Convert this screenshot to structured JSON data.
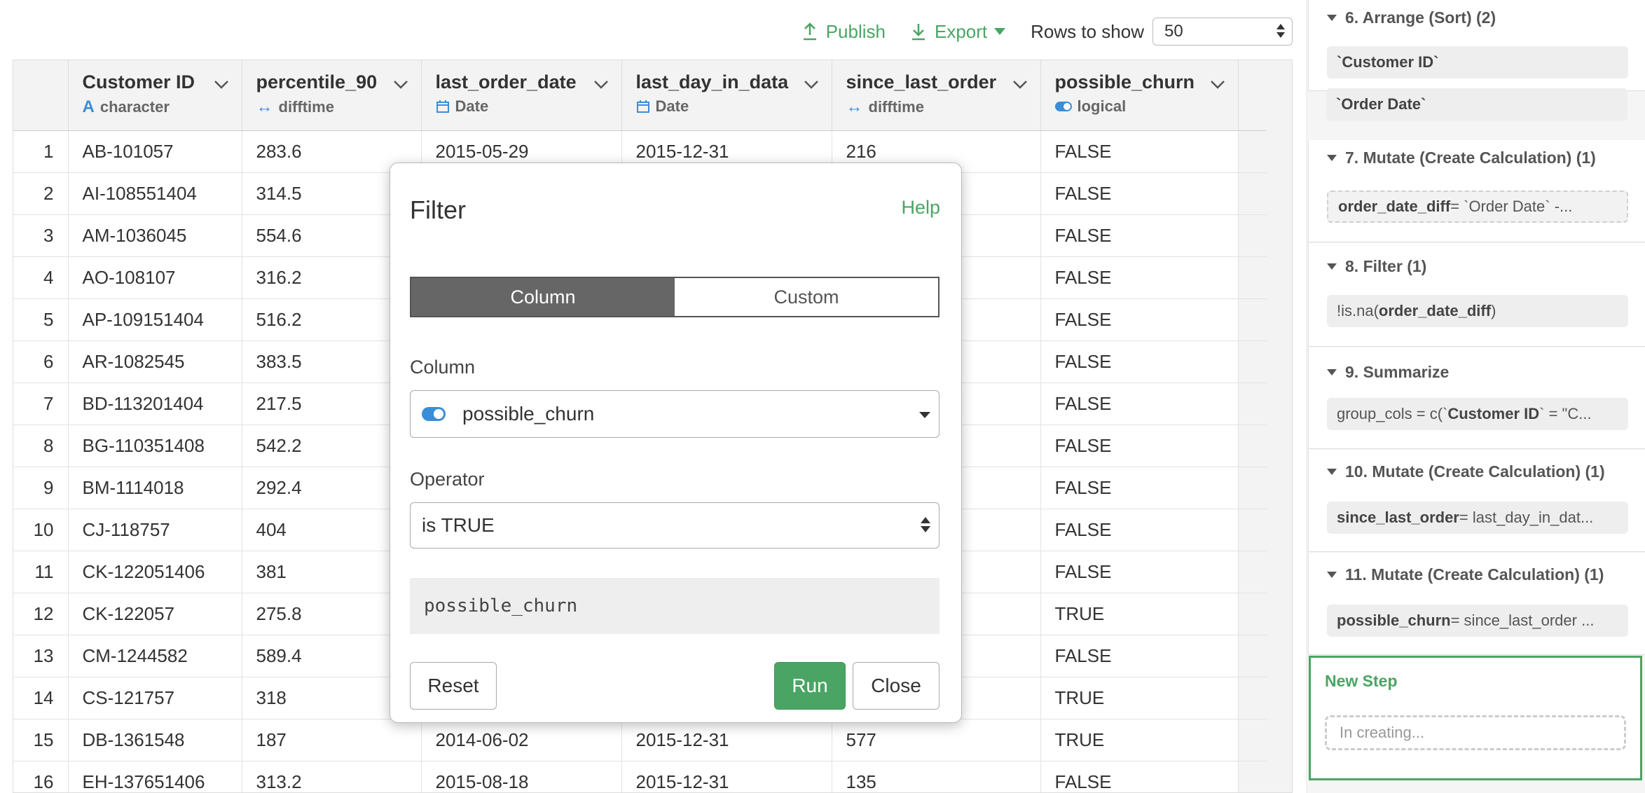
{
  "toolbar": {
    "publish_label": "Publish",
    "export_label": "Export",
    "rows_to_show_label": "Rows to show",
    "rows_to_show_value": "50"
  },
  "table": {
    "columns": [
      {
        "name": "Customer ID",
        "type": "character",
        "type_icon": "character-icon"
      },
      {
        "name": "percentile_90",
        "type": "difftime",
        "type_icon": "difftime-icon"
      },
      {
        "name": "last_order_date",
        "type": "Date",
        "type_icon": "calendar-icon"
      },
      {
        "name": "last_day_in_data",
        "type": "Date",
        "type_icon": "calendar-icon"
      },
      {
        "name": "since_last_order",
        "type": "difftime",
        "type_icon": "difftime-icon"
      },
      {
        "name": "possible_churn",
        "type": "logical",
        "type_icon": "toggle-icon"
      }
    ],
    "rows": [
      {
        "i": "1",
        "c": [
          "AB-101057",
          "283.6",
          "2015-05-29",
          "2015-12-31",
          "216",
          "FALSE"
        ]
      },
      {
        "i": "2",
        "c": [
          "AI-108551404",
          "314.5",
          "",
          "",
          "",
          "FALSE"
        ]
      },
      {
        "i": "3",
        "c": [
          "AM-1036045",
          "554.6",
          "",
          "",
          "",
          "FALSE"
        ]
      },
      {
        "i": "4",
        "c": [
          "AO-108107",
          "316.2",
          "",
          "",
          "",
          "FALSE"
        ]
      },
      {
        "i": "5",
        "c": [
          "AP-109151404",
          "516.2",
          "",
          "",
          "",
          "FALSE"
        ]
      },
      {
        "i": "6",
        "c": [
          "AR-1082545",
          "383.5",
          "",
          "",
          "",
          "FALSE"
        ]
      },
      {
        "i": "7",
        "c": [
          "BD-113201404",
          "217.5",
          "",
          "",
          "",
          "FALSE"
        ]
      },
      {
        "i": "8",
        "c": [
          "BG-110351408",
          "542.2",
          "",
          "",
          "",
          "FALSE"
        ]
      },
      {
        "i": "9",
        "c": [
          "BM-1114018",
          "292.4",
          "",
          "",
          "",
          "FALSE"
        ]
      },
      {
        "i": "10",
        "c": [
          "CJ-118757",
          "404",
          "",
          "",
          "",
          "FALSE"
        ]
      },
      {
        "i": "11",
        "c": [
          "CK-122051406",
          "381",
          "",
          "",
          "",
          "FALSE"
        ]
      },
      {
        "i": "12",
        "c": [
          "CK-122057",
          "275.8",
          "",
          "",
          "",
          "TRUE"
        ]
      },
      {
        "i": "13",
        "c": [
          "CM-1244582",
          "589.4",
          "",
          "",
          "",
          "FALSE"
        ]
      },
      {
        "i": "14",
        "c": [
          "CS-121757",
          "318",
          "",
          "",
          "",
          "TRUE"
        ]
      },
      {
        "i": "15",
        "c": [
          "DB-1361548",
          "187",
          "2014-06-02",
          "2015-12-31",
          "577",
          "TRUE"
        ]
      },
      {
        "i": "16",
        "c": [
          "EH-137651406",
          "313.2",
          "2015-08-18",
          "2015-12-31",
          "135",
          "FALSE"
        ]
      }
    ]
  },
  "dialog": {
    "title": "Filter",
    "help_label": "Help",
    "tabs": [
      "Column",
      "Custom"
    ],
    "active_tab": "Column",
    "column_label": "Column",
    "column_value": "possible_churn",
    "operator_label": "Operator",
    "operator_value": "is TRUE",
    "code_preview": "possible_churn",
    "reset_label": "Reset",
    "run_label": "Run",
    "close_label": "Close"
  },
  "steps": [
    {
      "title": "6. Arrange (Sort) (2)",
      "pills": [
        {
          "html": "`Customer ID`"
        },
        {
          "html": "`Order Date`"
        }
      ]
    },
    {
      "title": "7. Mutate (Create Calculation) (1)",
      "pills": [
        {
          "bold": "order_date_diff",
          "text": " = `Order Date` -..."
        }
      ]
    },
    {
      "title": "8. Filter (1)",
      "pills": [
        {
          "pre": "!is.na(",
          "bold": "order_date_diff",
          "text": ")"
        }
      ]
    },
    {
      "title": "9. Summarize",
      "pills": [
        {
          "pre": "group_cols = c(`",
          "bold": "Customer ID",
          "text": "` = \"C..."
        }
      ]
    },
    {
      "title": "10. Mutate (Create Calculation) (1)",
      "pills": [
        {
          "bold": "since_last_order",
          "text": " = last_day_in_dat..."
        }
      ]
    },
    {
      "title": "11. Mutate (Create Calculation) (1)",
      "pills": [
        {
          "bold": "possible_churn",
          "text": " = since_last_order ..."
        }
      ]
    }
  ],
  "new_step": {
    "title": "New Step",
    "placeholder": "In creating..."
  },
  "colors": {
    "accent_green": "#4aa564",
    "type_blue": "#3a8ed8"
  }
}
